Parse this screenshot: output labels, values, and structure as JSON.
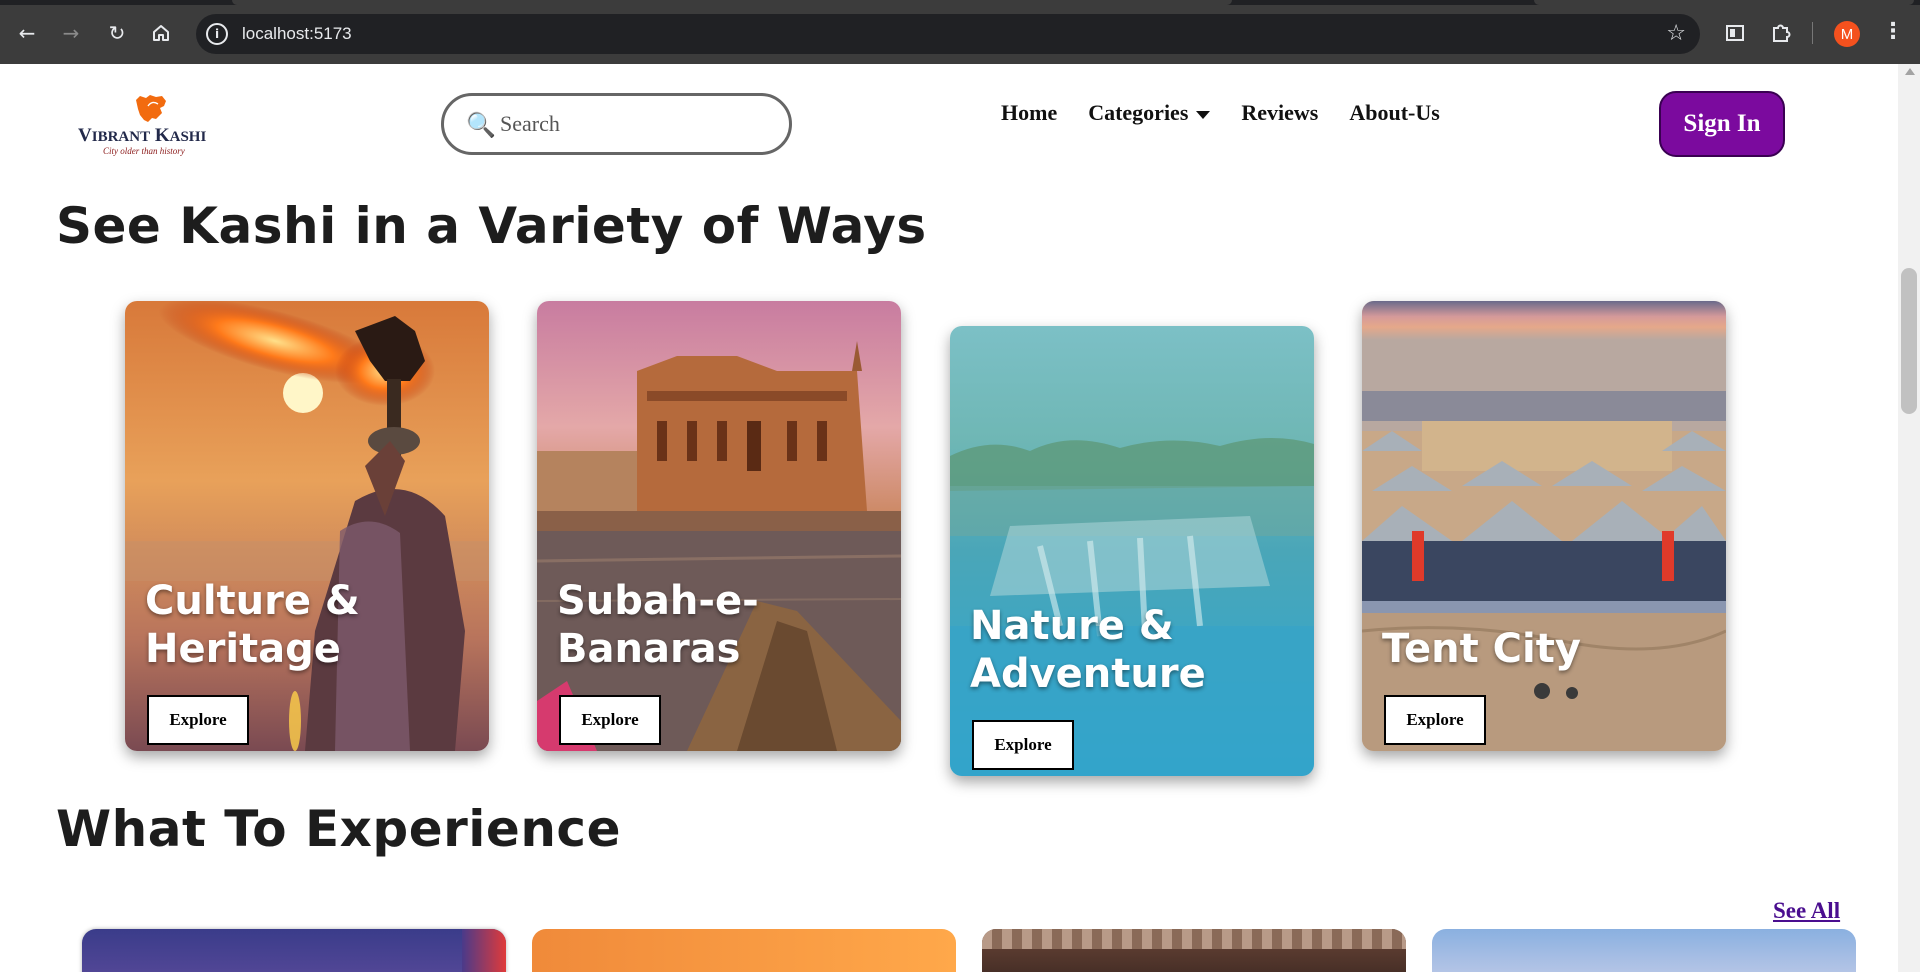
{
  "browser": {
    "url": "localhost:5173",
    "profile_initial": "M",
    "icons": [
      "back-icon",
      "forward-icon",
      "reload-icon",
      "home-icon",
      "site-info-icon",
      "bookmark-star-icon",
      "extension-icon",
      "puzzle-icon",
      "menu-kebab-icon"
    ]
  },
  "navbar": {
    "logo": {
      "name": "VIBRANT KASHI",
      "tagline": "City older than history"
    },
    "search_placeholder": "Search",
    "links": [
      {
        "label": "Home"
      },
      {
        "label": "Categories",
        "has_dropdown": true
      },
      {
        "label": "Reviews"
      },
      {
        "label": "About-Us"
      }
    ],
    "signin_label": "Sign In"
  },
  "section_ways": {
    "heading": "See Kashi in a Variety of Ways",
    "cards": [
      {
        "title": "Culture & Heritage",
        "button": "Explore"
      },
      {
        "title": "Subah-e-Banaras",
        "button": "Explore"
      },
      {
        "title": "Nature & Adventure",
        "button": "Explore"
      },
      {
        "title": "Tent City",
        "button": "Explore"
      }
    ]
  },
  "section_experience": {
    "heading": "What To Experience",
    "see_all": "See All"
  },
  "colors": {
    "accent": "#7b0a9e",
    "link": "#4a0e8f",
    "chrome_bg": "#3c3c3c",
    "profile_bg": "#f4511e"
  }
}
